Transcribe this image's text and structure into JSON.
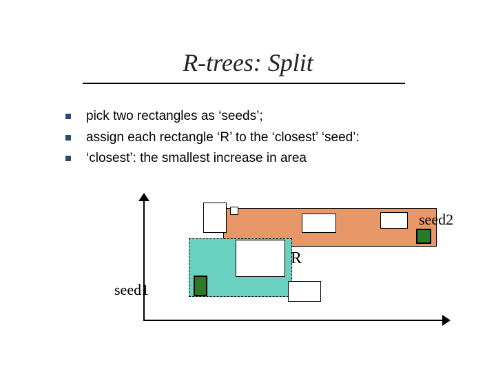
{
  "title": "R-trees: Split",
  "bullets": [
    "pick two rectangles as ‘seeds’;",
    "assign each rectangle ‘R’ to the ‘closest’ ‘seed’:",
    "‘closest’: the smallest increase in area"
  ],
  "labels": {
    "R": "R",
    "seed1": "seed1",
    "seed2": "seed2"
  }
}
